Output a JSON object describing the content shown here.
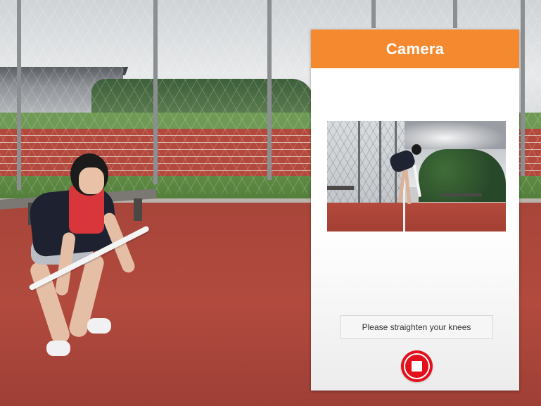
{
  "app": {
    "title": "Camera"
  },
  "feedback": {
    "message": "Please straighten your knees"
  },
  "controls": {
    "stop_icon": "stop-square-icon"
  },
  "colors": {
    "header": "#f5892f",
    "stop_button": "#e3101c"
  }
}
